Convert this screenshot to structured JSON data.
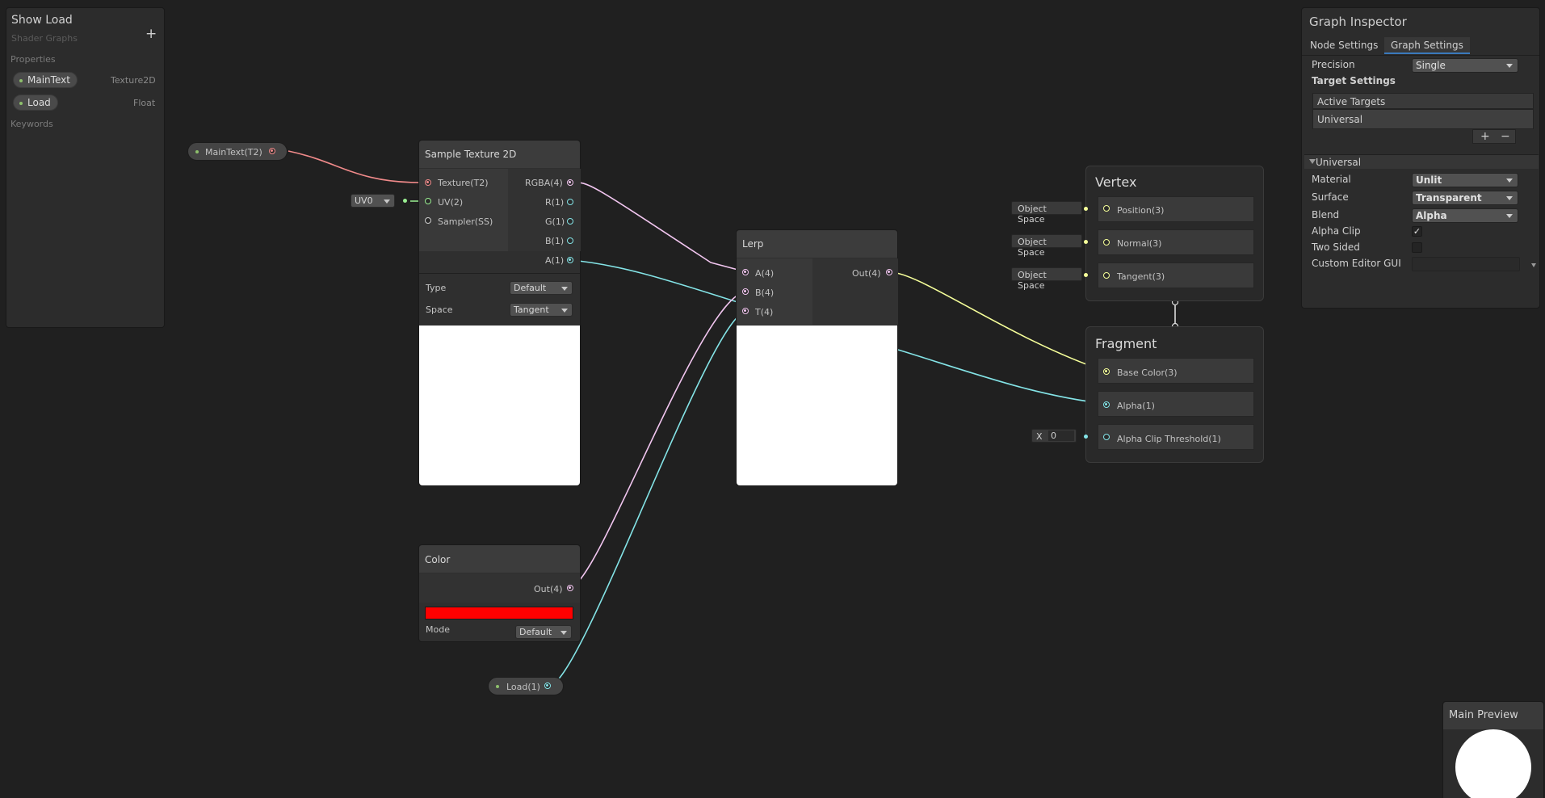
{
  "blackboard": {
    "title": "Show Load",
    "subtitle": "Shader Graphs",
    "add_icon": "+",
    "properties_label": "Properties",
    "properties": [
      {
        "name": "MainText",
        "type": "Texture2D"
      },
      {
        "name": "Load",
        "type": "Float"
      }
    ],
    "keywords_label": "Keywords"
  },
  "nodes": {
    "maintext_prop": {
      "label": "MainText(T2)"
    },
    "uv_dropdown": {
      "value": "UV0"
    },
    "sample_texture": {
      "title": "Sample Texture 2D",
      "inputs": [
        "Texture(T2)",
        "UV(2)",
        "Sampler(SS)"
      ],
      "outputs": [
        "RGBA(4)",
        "R(1)",
        "G(1)",
        "B(1)",
        "A(1)"
      ],
      "type_label": "Type",
      "type_value": "Default",
      "space_label": "Space",
      "space_value": "Tangent"
    },
    "lerp": {
      "title": "Lerp",
      "inputs": [
        "A(4)",
        "B(4)",
        "T(4)"
      ],
      "outputs": [
        "Out(4)"
      ]
    },
    "color": {
      "title": "Color",
      "output": "Out(4)",
      "swatch": "#ff0000",
      "mode_label": "Mode",
      "mode_value": "Default"
    },
    "load_prop": {
      "label": "Load(1)"
    }
  },
  "master": {
    "vertex": {
      "title": "Vertex",
      "blocks": [
        {
          "label": "Position(3)",
          "field": "Object Space"
        },
        {
          "label": "Normal(3)",
          "field": "Object Space"
        },
        {
          "label": "Tangent(3)",
          "field": "Object Space"
        }
      ]
    },
    "fragment": {
      "title": "Fragment",
      "blocks": [
        {
          "label": "Base Color(3)"
        },
        {
          "label": "Alpha(1)"
        },
        {
          "label": "Alpha Clip Threshold(1)",
          "field_prefix": "X",
          "field_value": "0"
        }
      ]
    }
  },
  "inspector": {
    "title": "Graph Inspector",
    "tabs": [
      "Node Settings",
      "Graph Settings"
    ],
    "active_tab": "Graph Settings",
    "precision_label": "Precision",
    "precision_value": "Single",
    "target_settings_label": "Target Settings",
    "active_targets_label": "Active Targets",
    "targets": [
      "Universal"
    ],
    "add_label": "+",
    "remove_label": "−",
    "section_label": "Universal",
    "rows": [
      {
        "label": "Material",
        "value": "Unlit"
      },
      {
        "label": "Surface",
        "value": "Transparent"
      },
      {
        "label": "Blend",
        "value": "Alpha"
      }
    ],
    "alpha_clip_label": "Alpha Clip",
    "alpha_clip_checked": true,
    "two_sided_label": "Two Sided",
    "two_sided_checked": false,
    "custom_editor_label": "Custom Editor GUI",
    "custom_editor_value": ""
  },
  "main_preview": {
    "title": "Main Preview"
  },
  "colors": {
    "texture_wire": "#f08a8a",
    "vector4_wire": "#f2c6f0",
    "float_wire": "#84e4e7",
    "vector3_wire": "#f6ff9a",
    "vector2_wire": "#9aef92"
  }
}
